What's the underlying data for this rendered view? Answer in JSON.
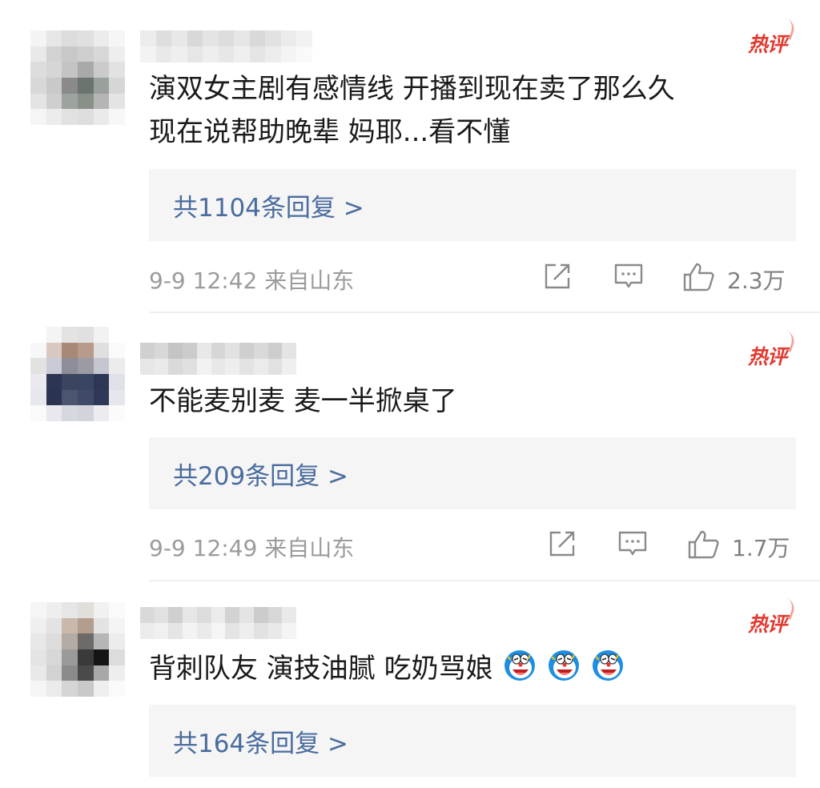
{
  "comments": [
    {
      "badge": "热评",
      "text_lines": [
        "演双女主剧有感情线 开播到现在卖了那么久",
        "现在说帮助晚辈 妈耶...看不懂"
      ],
      "replies_label": "共1104条回复 >",
      "time": "9-9 12:42",
      "location": "来自山东",
      "likes": "2.3万"
    },
    {
      "badge": "热评",
      "text_lines": [
        "不能麦别麦 麦一半掀桌了"
      ],
      "replies_label": "共209条回复 >",
      "time": "9-9 12:49",
      "location": "来自山东",
      "likes": "1.7万"
    },
    {
      "badge": "热评",
      "text_lines": [
        "背刺队友 演技油腻 吃奶骂娘"
      ],
      "emoji_count": 3,
      "emoji_icon": "doraemon-laughing-emoji",
      "replies_label": "共164条回复 >"
    }
  ],
  "icons": {
    "share": "share-icon",
    "comment": "comment-icon",
    "like": "thumbs-up-icon"
  },
  "colors": {
    "hot_badge": "#e23a30",
    "reply_link": "#4a6c9e",
    "reply_bg": "#f5f5f5",
    "meta_text": "#9b9b9b"
  }
}
